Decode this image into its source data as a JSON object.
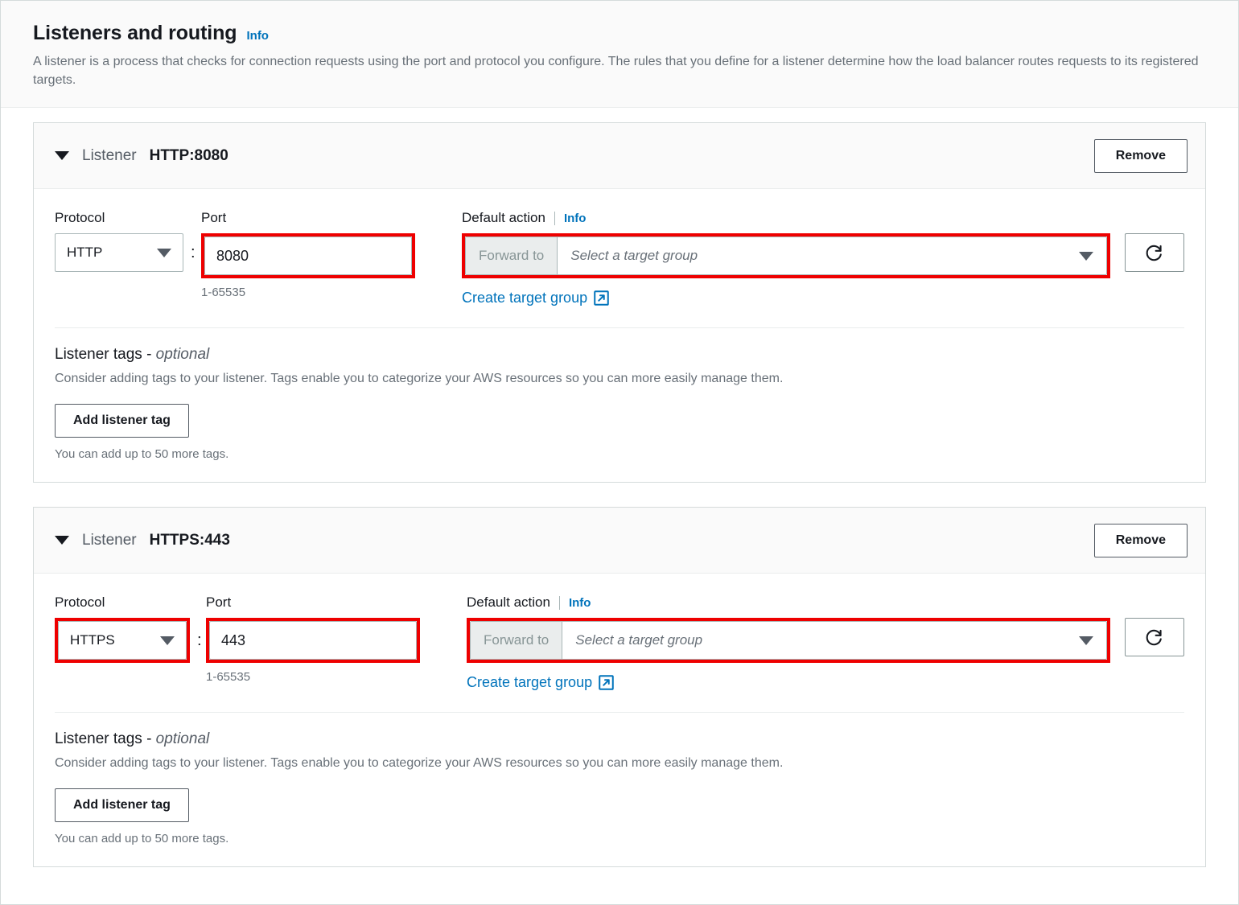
{
  "section": {
    "title": "Listeners and routing",
    "info_label": "Info",
    "description": "A listener is a process that checks for connection requests using the port and protocol you configure. The rules that you define for a listener determine how the load balancer routes requests to its registered targets."
  },
  "labels": {
    "listener_word": "Listener",
    "protocol": "Protocol",
    "port": "Port",
    "default_action": "Default action",
    "info": "Info",
    "port_hint": "1-65535",
    "forward_to": "Forward to",
    "target_group_placeholder": "Select a target group",
    "create_target_group": "Create target group",
    "remove": "Remove",
    "colon": ":",
    "tags_title": "Listener tags - ",
    "tags_optional": "optional",
    "tags_desc": "Consider adding tags to your listener. Tags enable you to categorize your AWS resources so you can more easily manage them.",
    "add_listener_tag": "Add listener tag",
    "tags_note": "You can add up to 50 more tags."
  },
  "icons": {
    "caret": "collapse-caret-icon",
    "dropdown": "chevron-down-icon",
    "refresh": "refresh-icon",
    "external": "external-link-icon"
  },
  "colors": {
    "annotation_red": "#ee0000",
    "link_blue": "#0073bb",
    "border_gray": "#aab7b8",
    "header_bg": "#fafafa"
  },
  "listeners": [
    {
      "name": "HTTP:8080",
      "protocol": "HTTP",
      "port": "8080",
      "forward_to": "Forward to",
      "target_group": "Select a target group",
      "highlight_protocol": false,
      "highlight_port": true,
      "highlight_action": true
    },
    {
      "name": "HTTPS:443",
      "protocol": "HTTPS",
      "port": "443",
      "forward_to": "Forward to",
      "target_group": "Select a target group",
      "highlight_protocol": true,
      "highlight_port": true,
      "highlight_action": true
    }
  ]
}
